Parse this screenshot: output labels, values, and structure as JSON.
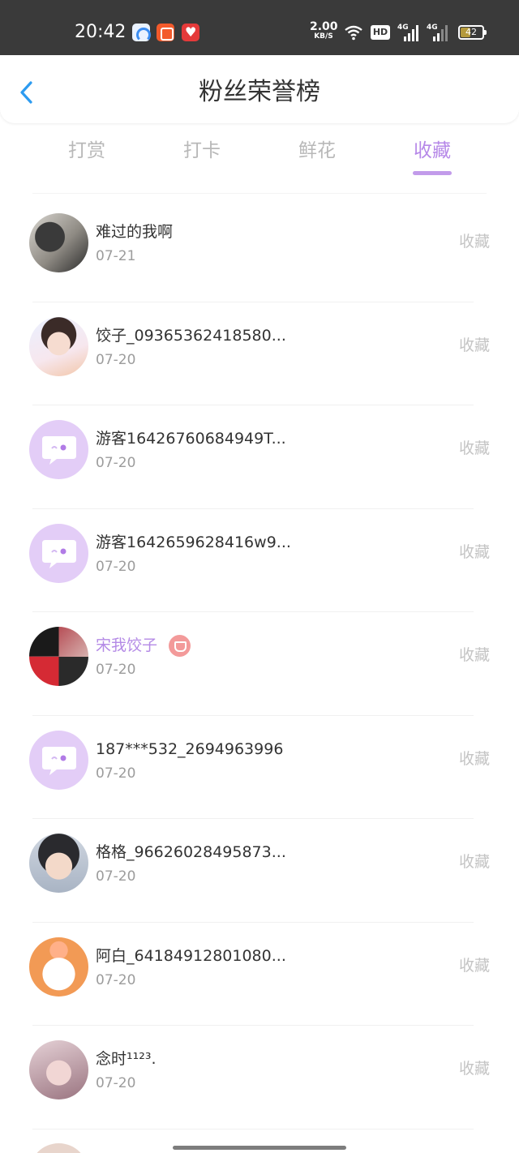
{
  "status_bar": {
    "time": "20:42",
    "net_speed_value": "2.00",
    "net_speed_unit": "KB/S",
    "hd_label": "HD",
    "signal1_label": "4G",
    "signal2_label": "4G",
    "battery_percent": "42"
  },
  "header": {
    "title": "粉丝荣誉榜"
  },
  "tabs": [
    {
      "label": "打赏"
    },
    {
      "label": "打卡"
    },
    {
      "label": "鲜花"
    },
    {
      "label": "收藏"
    }
  ],
  "active_tab_color": "#b688e8",
  "rows": [
    {
      "name": "难过的我啊",
      "date": "07-21",
      "action": "收藏"
    },
    {
      "name": "饺子_09365362418580...",
      "date": "07-20",
      "action": "收藏"
    },
    {
      "name": "游客16426760684949T...",
      "date": "07-20",
      "action": "收藏"
    },
    {
      "name": "游客1642659628416w9...",
      "date": "07-20",
      "action": "收藏"
    },
    {
      "name": "宋我饺子",
      "date": "07-20",
      "action": "收藏"
    },
    {
      "name": "187***532_2694963996",
      "date": "07-20",
      "action": "收藏"
    },
    {
      "name": "格格_96626028495873...",
      "date": "07-20",
      "action": "收藏"
    },
    {
      "name": "阿白_64184912801080...",
      "date": "07-20",
      "action": "收藏"
    },
    {
      "name": "念时¹¹²³.",
      "date": "07-20",
      "action": "收藏"
    }
  ]
}
